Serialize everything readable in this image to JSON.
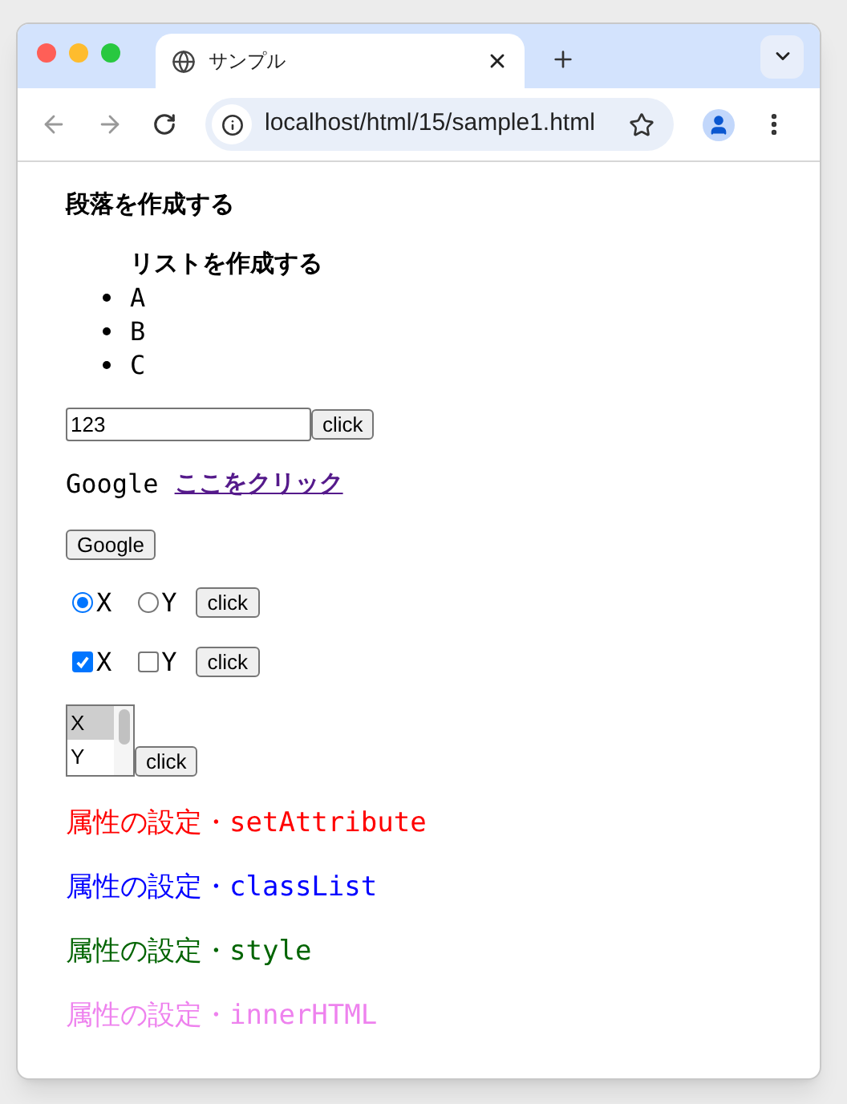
{
  "window": {
    "tab_title": "サンプル",
    "url": "localhost/html/15/sample1.html"
  },
  "content": {
    "heading": "段落を作成する",
    "list": {
      "title": "リストを作成する",
      "items": [
        "A",
        "B",
        "C"
      ]
    },
    "text_input": {
      "value": "123",
      "button": "click"
    },
    "link_row": {
      "text": "Google",
      "link": "ここをクリック"
    },
    "google_button": "Google",
    "radios": [
      {
        "label": "X",
        "selected": true
      },
      {
        "label": "Y",
        "selected": false
      }
    ],
    "radio_button": "click",
    "checkboxes": [
      {
        "label": "X",
        "checked": true
      },
      {
        "label": "Y",
        "checked": false
      }
    ],
    "checkbox_button": "click",
    "listbox": {
      "options": [
        {
          "label": "X",
          "selected": true
        },
        {
          "label": "Y",
          "selected": false
        }
      ],
      "button": "click"
    },
    "styled_lines": [
      {
        "text": "属性の設定・setAttribute",
        "color": "#ff0000"
      },
      {
        "text": "属性の設定・classList",
        "color": "#0000ff"
      },
      {
        "text": "属性の設定・style",
        "color": "#006400"
      },
      {
        "text": "属性の設定・innerHTML",
        "color": "#ee82ee"
      }
    ]
  }
}
